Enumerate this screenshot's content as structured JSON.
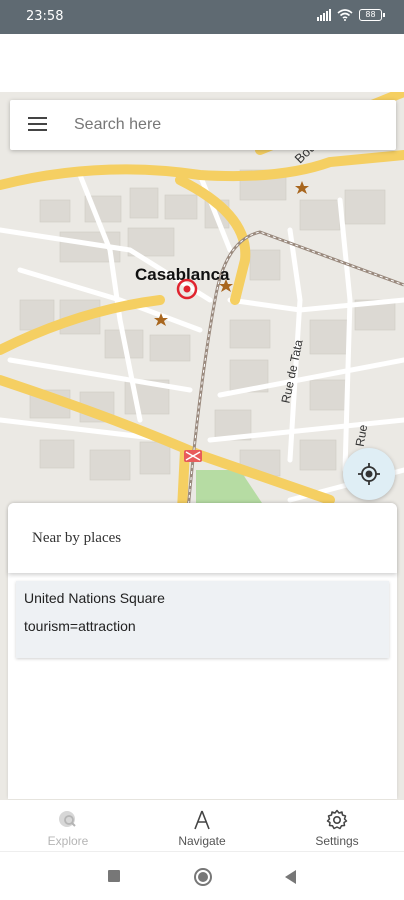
{
  "status_bar": {
    "time": "23:58",
    "battery": "88"
  },
  "search": {
    "placeholder": "Search here"
  },
  "map": {
    "labels": {
      "city": "Casablanca",
      "street_bou": "Bou",
      "street_tata": "Rue de Tata",
      "street_rue": "Rue"
    },
    "colors": {
      "land": "#ebe9e4",
      "road_major": "#f5cf62",
      "road_minor": "#ffffff",
      "building": "#dcd9d3",
      "park": "#b6dca3",
      "poi_star": "#a8661e",
      "marker": "#e0242f"
    }
  },
  "nearby": {
    "title": "Near by places",
    "places": [
      {
        "name": "United Nations Square",
        "tag": "tourism=attraction"
      }
    ]
  },
  "bottom_nav": {
    "items": [
      {
        "label": "Explore",
        "icon": "explore-icon",
        "state": "disabled"
      },
      {
        "label": "Navigate",
        "icon": "navigate-icon",
        "state": "enabled"
      },
      {
        "label": "Settings",
        "icon": "settings-icon",
        "state": "enabled"
      }
    ]
  }
}
